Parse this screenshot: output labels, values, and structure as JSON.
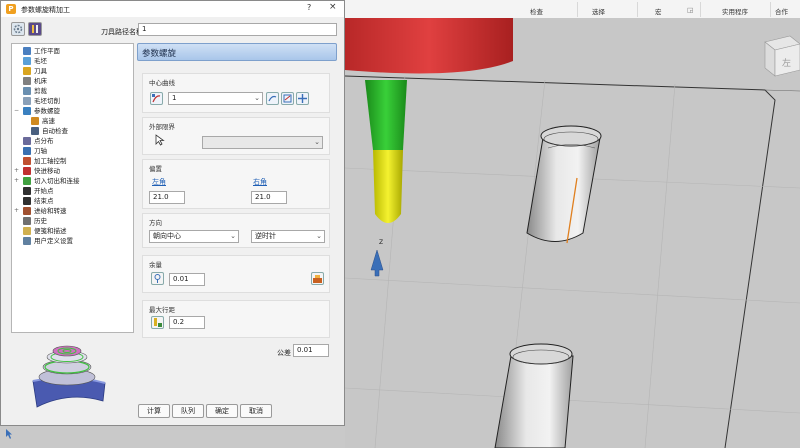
{
  "ribbon": {
    "groups": [
      "检查",
      "选择",
      "宏",
      "实用程序",
      "合作"
    ]
  },
  "dialog": {
    "title": "参数螺旋精加工",
    "help": "?",
    "close": "×",
    "toolpath_name_label": "刀具路径名称",
    "toolpath_name_value": "1",
    "tree": [
      {
        "label": "工作平面",
        "icon": "workplane-icon",
        "color": "#4a7fc0"
      },
      {
        "label": "毛坯",
        "icon": "block-icon",
        "color": "#5aa0d8"
      },
      {
        "label": "刀具",
        "icon": "tool-icon",
        "color": "#d9a520"
      },
      {
        "label": "机床",
        "icon": "machine-icon",
        "color": "#808080"
      },
      {
        "label": "剪裁",
        "icon": "limit-icon",
        "color": "#6a8fb0"
      },
      {
        "label": "毛坯切削",
        "icon": "stock-cut-icon",
        "color": "#8aa0b8"
      },
      {
        "label": "参数螺旋",
        "icon": "spiral-icon",
        "color": "#3a80c0"
      },
      {
        "label": "高速",
        "icon": "high-speed-icon",
        "color": "#d08a20"
      },
      {
        "label": "自动检查",
        "icon": "auto-check-icon",
        "color": "#4a6080"
      },
      {
        "label": "点分布",
        "icon": "point-dist-icon",
        "color": "#6a6a9a"
      },
      {
        "label": "刀轴",
        "icon": "tool-axis-icon",
        "color": "#3a70b0"
      },
      {
        "label": "加工轴控制",
        "icon": "axis-control-icon",
        "color": "#c05030"
      },
      {
        "label": "快进移动",
        "icon": "rapid-move-icon",
        "color": "#c03030"
      },
      {
        "label": "切入切出和连接",
        "icon": "leads-links-icon",
        "color": "#40a040"
      },
      {
        "label": "开始点",
        "icon": "start-point-icon",
        "color": "#303030"
      },
      {
        "label": "结束点",
        "icon": "end-point-icon",
        "color": "#303030"
      },
      {
        "label": "进给和转速",
        "icon": "feeds-speeds-icon",
        "color": "#a05030"
      },
      {
        "label": "历史",
        "icon": "history-icon",
        "color": "#707070"
      },
      {
        "label": "便笺和描述",
        "icon": "notes-icon",
        "color": "#d0b050"
      },
      {
        "label": "用户定义设置",
        "icon": "user-settings-icon",
        "color": "#6080a0"
      }
    ],
    "section_header": "参数螺旋",
    "center_curve": {
      "title": "中心曲线",
      "value": "1"
    },
    "outer_boundary": {
      "title": "外部限界",
      "value": ""
    },
    "offset": {
      "title": "偏置",
      "left_label": "左角",
      "left_value": "21.0",
      "right_label": "右角",
      "right_value": "21.0"
    },
    "direction": {
      "title": "方向",
      "toward": "朝向中心",
      "rotation": "逆时针"
    },
    "allowance": {
      "title": "余量",
      "value": "0.01"
    },
    "stepover": {
      "title": "最大行距",
      "value": "0.2"
    },
    "tolerance": {
      "label": "公差",
      "value": "0.01"
    },
    "buttons": {
      "calculate": "计算",
      "queue": "队列",
      "ok": "确定",
      "cancel": "取消"
    }
  },
  "viewport": {
    "axis_label": "Z",
    "viewcube_label": "左"
  }
}
